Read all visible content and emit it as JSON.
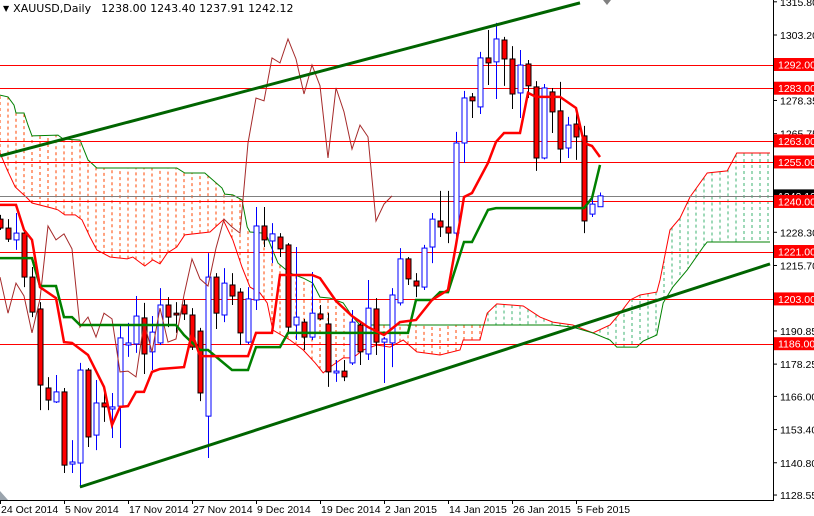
{
  "header": {
    "symbol_timeframe": "XAUUSD,Daily",
    "ohlc": "1238.00 1243.40 1237.91 1242.12",
    "menu_icon": "triangle-down-icon"
  },
  "colors": {
    "bull_body": "#ffffff",
    "bull_outline": "#0000ff",
    "bear_body": "#ff0000",
    "bear_outline": "#000000",
    "tenkan": "#ff0000",
    "kijun": "#008000",
    "chikou": "#a52a2a",
    "senkou_a": "#ff0000",
    "senkou_b": "#008000",
    "cloud_bear": "#ff4500",
    "cloud_bull": "#3cb371",
    "trendline": "#006400",
    "level": "#ff0000",
    "level_label_bg": "#ff0000",
    "current_price_line": "#808080",
    "current_price_label_bg": "#000000"
  },
  "chart_data": {
    "type": "candlestick",
    "title": "XAUUSD,Daily",
    "ylim": [
      1126.2,
      1316.6
    ],
    "price_ticks": [
      "1315.80",
      "1303.20",
      "1278.35",
      "1265.75",
      "1228.30",
      "1215.70",
      "1190.85",
      "1178.25",
      "1166.00",
      "1153.40",
      "1140.80",
      "1128.55"
    ],
    "date_labels": [
      {
        "bar": 0,
        "label": "24 Oct 2014"
      },
      {
        "bar": 8,
        "label": "5 Nov 2014"
      },
      {
        "bar": 16,
        "label": "17 Nov 2014"
      },
      {
        "bar": 24,
        "label": "27 Nov 2014"
      },
      {
        "bar": 32,
        "label": "9 Dec 2014"
      },
      {
        "bar": 40,
        "label": "19 Dec 2014"
      },
      {
        "bar": 48,
        "label": "2 Jan 2015"
      },
      {
        "bar": 56,
        "label": "14 Jan 2015"
      },
      {
        "bar": 64,
        "label": "26 Jan 2015"
      },
      {
        "bar": 72,
        "label": "5 Feb 2015"
      }
    ],
    "horizontal_levels": [
      "1292.00",
      "1283.00",
      "1263.00",
      "1255.00",
      "1240.00",
      "1221.00",
      "1203.00",
      "1186.00"
    ],
    "current_price": "1242.12",
    "candles_ohlc": [
      [
        1233.3,
        1234.9,
        1229.2,
        1229.9
      ],
      [
        1229.9,
        1233.3,
        1224.6,
        1225.7
      ],
      [
        1225.4,
        1235.6,
        1221.6,
        1228.0
      ],
      [
        1228.0,
        1229.2,
        1207.5,
        1211.3
      ],
      [
        1211.3,
        1215.1,
        1196.1,
        1198.0
      ],
      [
        1199.2,
        1201.8,
        1160.8,
        1170.3
      ],
      [
        1169.2,
        1173.3,
        1160.8,
        1164.6
      ],
      [
        1163.9,
        1174.1,
        1163.5,
        1167.7
      ],
      [
        1167.7,
        1169.2,
        1136.9,
        1139.9
      ],
      [
        1140.3,
        1149.4,
        1136.9,
        1141.1
      ],
      [
        1140.7,
        1178.7,
        1131.2,
        1176.0
      ],
      [
        1176.0,
        1176.8,
        1146.8,
        1150.6
      ],
      [
        1151.3,
        1172.2,
        1145.6,
        1163.5
      ],
      [
        1163.5,
        1169.6,
        1156.3,
        1162.0
      ],
      [
        1161.2,
        1167.3,
        1150.2,
        1162.0
      ],
      [
        1162.3,
        1193.1,
        1146.4,
        1188.2
      ],
      [
        1185.5,
        1193.9,
        1181.0,
        1186.3
      ],
      [
        1185.9,
        1204.1,
        1182.5,
        1196.5
      ],
      [
        1195.8,
        1201.5,
        1174.5,
        1182.1
      ],
      [
        1182.9,
        1196.5,
        1176.0,
        1190.4
      ],
      [
        1186.3,
        1207.1,
        1185.5,
        1200.7
      ],
      [
        1200.7,
        1203.7,
        1192.3,
        1196.1
      ],
      [
        1197.6,
        1201.8,
        1190.1,
        1196.9
      ],
      [
        1200.7,
        1202.6,
        1195.0,
        1197.3
      ],
      [
        1196.9,
        1199.5,
        1183.6,
        1184.7
      ],
      [
        1190.8,
        1192.0,
        1164.2,
        1167.3
      ],
      [
        1158.5,
        1220.4,
        1142.6,
        1211.3
      ],
      [
        1211.3,
        1212.8,
        1191.6,
        1197.6
      ],
      [
        1196.9,
        1214.7,
        1194.2,
        1209.0
      ],
      [
        1208.3,
        1212.8,
        1200.7,
        1204.1
      ],
      [
        1205.6,
        1207.1,
        1185.5,
        1190.1
      ],
      [
        1186.6,
        1207.5,
        1185.9,
        1203.0
      ],
      [
        1202.6,
        1237.9,
        1198.8,
        1230.7
      ],
      [
        1230.7,
        1237.9,
        1222.7,
        1225.4
      ],
      [
        1225.0,
        1231.8,
        1216.6,
        1227.7
      ],
      [
        1226.5,
        1228.0,
        1218.9,
        1222.0
      ],
      [
        1223.5,
        1224.2,
        1190.4,
        1192.3
      ],
      [
        1193.1,
        1222.7,
        1187.4,
        1196.1
      ],
      [
        1194.2,
        1195.4,
        1183.6,
        1188.5
      ],
      [
        1188.5,
        1213.2,
        1187.4,
        1197.6
      ],
      [
        1197.3,
        1200.7,
        1195.0,
        1195.4
      ],
      [
        1193.5,
        1197.6,
        1169.6,
        1175.3
      ],
      [
        1174.9,
        1179.8,
        1171.5,
        1175.6
      ],
      [
        1175.6,
        1179.8,
        1171.8,
        1173.4
      ],
      [
        1178.7,
        1198.8,
        1177.9,
        1194.2
      ],
      [
        1193.1,
        1193.9,
        1177.9,
        1182.9
      ],
      [
        1182.1,
        1210.2,
        1179.8,
        1199.5
      ],
      [
        1199.2,
        1203.3,
        1181.7,
        1186.6
      ],
      [
        1186.6,
        1188.5,
        1171.1,
        1187.8
      ],
      [
        1186.3,
        1207.1,
        1177.1,
        1204.5
      ],
      [
        1201.5,
        1222.3,
        1200.5,
        1218.2
      ],
      [
        1218.2,
        1218.9,
        1208.3,
        1210.6
      ],
      [
        1209.8,
        1212.8,
        1203.7,
        1207.9
      ],
      [
        1207.5,
        1223.5,
        1206.4,
        1222.3
      ],
      [
        1222.7,
        1235.6,
        1216.6,
        1233.3
      ],
      [
        1232.6,
        1244.0,
        1226.5,
        1230.3
      ],
      [
        1230.3,
        1244.0,
        1224.2,
        1228.0
      ],
      [
        1228.0,
        1266.4,
        1225.4,
        1262.2
      ],
      [
        1262.2,
        1282.0,
        1254.6,
        1279.3
      ],
      [
        1279.7,
        1281.2,
        1271.7,
        1278.2
      ],
      [
        1275.9,
        1296.8,
        1273.2,
        1294.5
      ],
      [
        1294.5,
        1305.1,
        1284.2,
        1292.6
      ],
      [
        1293.0,
        1307.8,
        1278.9,
        1301.7
      ],
      [
        1301.3,
        1302.5,
        1283.9,
        1294.1
      ],
      [
        1294.1,
        1299.0,
        1275.1,
        1280.8
      ],
      [
        1281.2,
        1297.5,
        1271.7,
        1291.8
      ],
      [
        1292.2,
        1293.7,
        1279.3,
        1283.9
      ],
      [
        1283.5,
        1285.7,
        1251.6,
        1256.5
      ],
      [
        1256.5,
        1284.6,
        1256.0,
        1283.1
      ],
      [
        1281.6,
        1283.1,
        1266.0,
        1274.0
      ],
      [
        1274.4,
        1285.4,
        1254.6,
        1259.9
      ],
      [
        1260.3,
        1272.1,
        1256.5,
        1269.0
      ],
      [
        1269.4,
        1273.6,
        1255.8,
        1264.5
      ],
      [
        1264.9,
        1268.7,
        1228.0,
        1232.6
      ],
      [
        1235.2,
        1241.7,
        1234.1,
        1239.0
      ],
      [
        1238.0,
        1243.4,
        1237.91,
        1242.12
      ]
    ],
    "ichimoku": {
      "chikou_shift_bars": 26,
      "tenkan": [
        [
          0,
          1238.7
        ],
        [
          2,
          1238.7
        ],
        [
          3,
          1229.2
        ],
        [
          4,
          1225.4
        ],
        [
          5,
          1207.5
        ],
        [
          7,
          1203.3
        ],
        [
          8,
          1186.6
        ],
        [
          9,
          1186.3
        ],
        [
          11,
          1181.7
        ],
        [
          13,
          1169.6
        ],
        [
          14,
          1155.1
        ],
        [
          15,
          1162.0
        ],
        [
          16,
          1162.3
        ],
        [
          17,
          1167.7
        ],
        [
          18,
          1167.7
        ],
        [
          19,
          1175.3
        ],
        [
          20,
          1176.4
        ],
        [
          23,
          1177.1
        ],
        [
          24,
          1190.1
        ],
        [
          25,
          1181.3
        ],
        [
          31,
          1181.3
        ],
        [
          32,
          1190.1
        ],
        [
          34,
          1190.1
        ],
        [
          35,
          1212.1
        ],
        [
          39,
          1212.1
        ],
        [
          40,
          1210.9
        ],
        [
          42,
          1202.2
        ],
        [
          44,
          1196.5
        ],
        [
          46,
          1192.3
        ],
        [
          48,
          1189.3
        ],
        [
          50,
          1194.2
        ],
        [
          52,
          1195.0
        ],
        [
          54,
          1202.6
        ],
        [
          56,
          1206.4
        ],
        [
          57,
          1223.5
        ],
        [
          58,
          1241.7
        ],
        [
          59,
          1243.2
        ],
        [
          61,
          1254.6
        ],
        [
          62,
          1262.6
        ],
        [
          63,
          1266.0
        ],
        [
          65,
          1266.0
        ],
        [
          66,
          1281.2
        ],
        [
          67,
          1279.7
        ],
        [
          70,
          1279.7
        ],
        [
          72,
          1275.5
        ],
        [
          73,
          1262.2
        ],
        [
          74,
          1261.1
        ],
        [
          75,
          1256.9
        ]
      ],
      "kijun": [
        [
          0,
          1218.5
        ],
        [
          4,
          1218.5
        ],
        [
          5,
          1207.9
        ],
        [
          7,
          1207.9
        ],
        [
          8,
          1196.1
        ],
        [
          9,
          1196.1
        ],
        [
          10,
          1193.1
        ],
        [
          22,
          1193.1
        ],
        [
          23,
          1189.3
        ],
        [
          25,
          1183.6
        ],
        [
          26,
          1183.6
        ],
        [
          29,
          1176.0
        ],
        [
          31,
          1176.0
        ],
        [
          32,
          1184.7
        ],
        [
          35,
          1184.7
        ],
        [
          36,
          1190.1
        ],
        [
          51,
          1190.1
        ],
        [
          52,
          1202.6
        ],
        [
          54,
          1202.6
        ],
        [
          55,
          1205.6
        ],
        [
          56,
          1205.6
        ],
        [
          58,
          1224.6
        ],
        [
          59,
          1224.6
        ],
        [
          61,
          1236.8
        ],
        [
          62,
          1237.5
        ],
        [
          73,
          1237.5
        ],
        [
          74,
          1241.3
        ],
        [
          75,
          1253.9
        ]
      ],
      "senkou_a": [
        [
          0,
          1258.4
        ],
        [
          0.9,
          1252.0
        ],
        [
          1.9,
          1245.5
        ],
        [
          3.4,
          1241.3
        ],
        [
          4,
          1239.4
        ],
        [
          6.5,
          1237.5
        ],
        [
          7.25,
          1236.8
        ],
        [
          8.1,
          1234.9
        ],
        [
          9.4,
          1234.9
        ],
        [
          10.25,
          1233.0
        ],
        [
          11.25,
          1226.5
        ],
        [
          12.1,
          1221.6
        ],
        [
          13.75,
          1218.9
        ],
        [
          15.9,
          1218.2
        ],
        [
          16.6,
          1218.9
        ],
        [
          18.1,
          1215.5
        ],
        [
          19.1,
          1217.8
        ],
        [
          20,
          1216.3
        ],
        [
          20.9,
          1220.4
        ],
        [
          22.1,
          1222.7
        ],
        [
          23.1,
          1227.3
        ],
        [
          26.25,
          1228.4
        ],
        [
          27.9,
          1233.0
        ],
        [
          29.1,
          1225.4
        ],
        [
          30.25,
          1215.1
        ],
        [
          31.25,
          1207.5
        ],
        [
          32.5,
          1205.3
        ],
        [
          33.4,
          1201.5
        ],
        [
          34.1,
          1191.2
        ],
        [
          36.25,
          1187.4
        ],
        [
          37.9,
          1183.6
        ],
        [
          39.4,
          1178.7
        ],
        [
          40.4,
          1174.9
        ],
        [
          41.25,
          1177.1
        ],
        [
          42.9,
          1180.6
        ],
        [
          44.1,
          1180.6
        ],
        [
          45.4,
          1183.6
        ],
        [
          47.1,
          1185.5
        ],
        [
          48.75,
          1184.7
        ],
        [
          50.4,
          1187.4
        ],
        [
          52.1,
          1182.9
        ],
        [
          55,
          1181.7
        ],
        [
          57.5,
          1183.6
        ],
        [
          57.9,
          1187.4
        ],
        [
          60,
          1187.4
        ],
        [
          60.4,
          1192.3
        ],
        [
          60.9,
          1197.6
        ],
        [
          62.1,
          1201.1
        ],
        [
          65.4,
          1200.3
        ],
        [
          67.5,
          1196.1
        ],
        [
          69.1,
          1194.2
        ],
        [
          71.6,
          1193.1
        ],
        [
          74.1,
          1190.1
        ],
        [
          76.25,
          1193.1
        ],
        [
          77.5,
          1197.6
        ],
        [
          78.75,
          1202.6
        ],
        [
          80,
          1204.5
        ],
        [
          82.1,
          1205.6
        ],
        [
          82.5,
          1210.2
        ],
        [
          83.75,
          1229.2
        ],
        [
          85,
          1233.7
        ],
        [
          86.25,
          1241.7
        ],
        [
          88.4,
          1250.8
        ],
        [
          90.9,
          1251.6
        ],
        [
          92.1,
          1258.4
        ],
        [
          96.25,
          1258.4
        ]
      ],
      "senkou_b": [
        [
          0,
          1280.4
        ],
        [
          1,
          1279.7
        ],
        [
          1.75,
          1276.6
        ],
        [
          2,
          1273.6
        ],
        [
          3,
          1273.6
        ],
        [
          3.5,
          1269.0
        ],
        [
          4,
          1264.9
        ],
        [
          7.25,
          1265.2
        ],
        [
          7.9,
          1263.7
        ],
        [
          10,
          1263.3
        ],
        [
          11,
          1255.8
        ],
        [
          12.1,
          1252.7
        ],
        [
          22.1,
          1252.7
        ],
        [
          23.1,
          1250.8
        ],
        [
          25.6,
          1250.8
        ],
        [
          27.75,
          1245.1
        ],
        [
          28.1,
          1242.8
        ],
        [
          29.1,
          1242.5
        ],
        [
          30.25,
          1240.6
        ],
        [
          30.9,
          1230.3
        ],
        [
          31.25,
          1228.4
        ],
        [
          32.9,
          1228.0
        ],
        [
          33.4,
          1226.5
        ],
        [
          34.75,
          1216.6
        ],
        [
          36.25,
          1212.8
        ],
        [
          37.9,
          1210.9
        ],
        [
          39.1,
          1209.0
        ],
        [
          40,
          1203.7
        ],
        [
          41.25,
          1203.3
        ],
        [
          42.9,
          1201.5
        ],
        [
          44.1,
          1196.1
        ],
        [
          45,
          1193.1
        ],
        [
          69.1,
          1193.1
        ],
        [
          71.6,
          1192.3
        ],
        [
          74.1,
          1190.1
        ],
        [
          76.25,
          1187.4
        ],
        [
          77.1,
          1184.7
        ],
        [
          79.6,
          1184.7
        ],
        [
          80.4,
          1187.0
        ],
        [
          82.1,
          1189.3
        ],
        [
          82.9,
          1201.5
        ],
        [
          84.1,
          1207.5
        ],
        [
          85.9,
          1214.0
        ],
        [
          87.9,
          1222.7
        ],
        [
          88.4,
          1224.6
        ],
        [
          96.25,
          1224.6
        ]
      ]
    },
    "trendlines": [
      {
        "name": "upper-channel",
        "from": [
          0,
          1257.3
        ],
        "to": [
          72.5,
          1315.4
        ]
      },
      {
        "name": "lower-channel",
        "from": [
          10,
          1131.6
        ],
        "to": [
          96.25,
          1216.3
        ]
      }
    ]
  }
}
